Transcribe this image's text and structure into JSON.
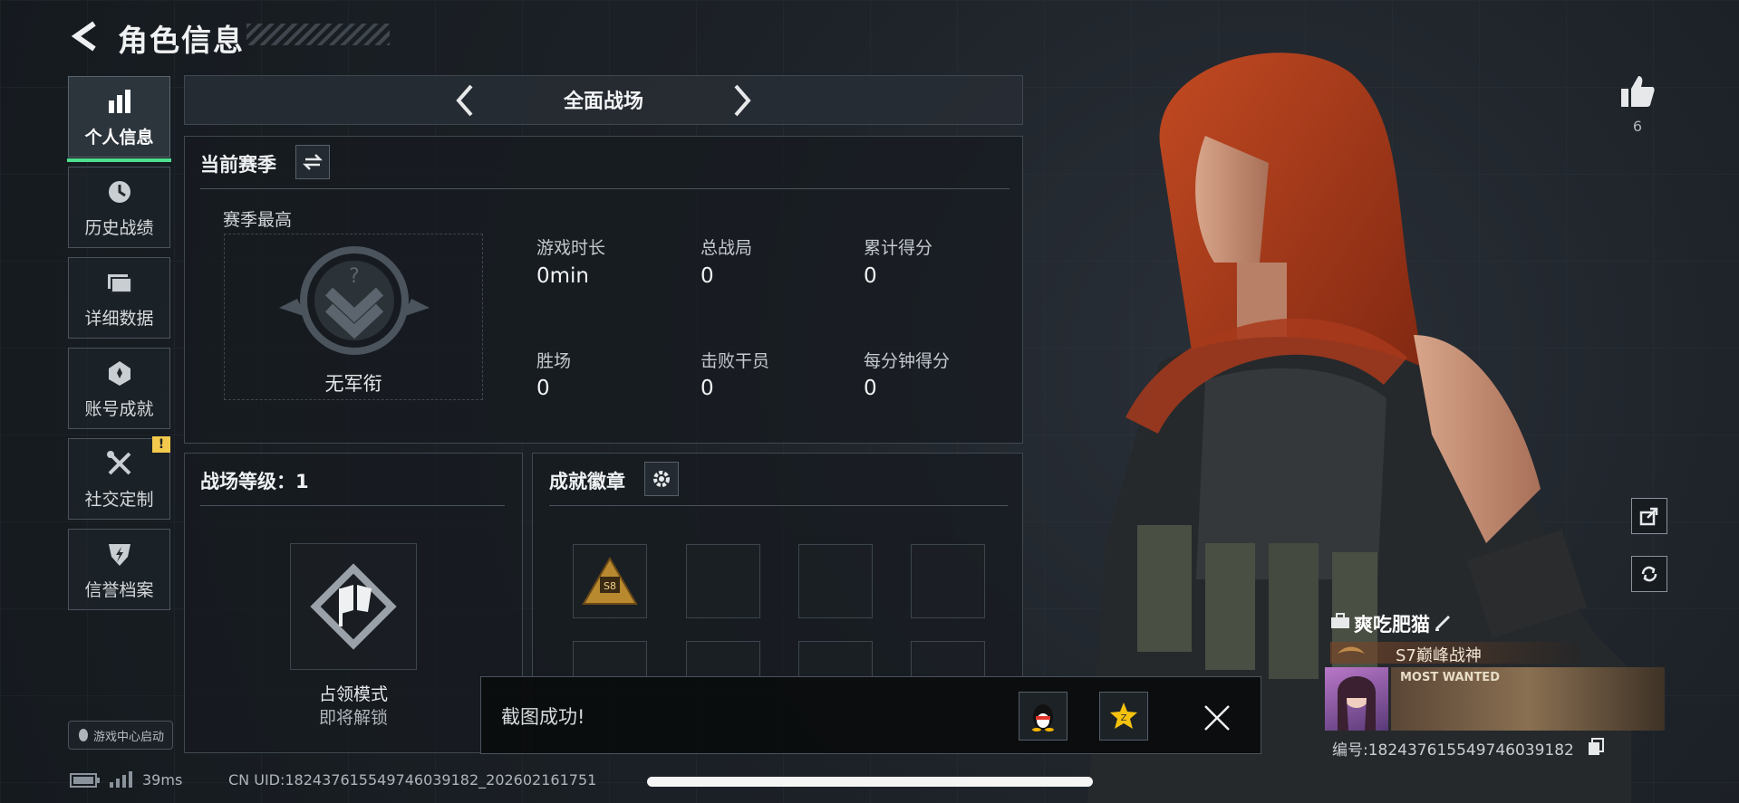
{
  "header": {
    "title": "角色信息"
  },
  "nav": [
    {
      "label": "个人信息",
      "icon": "bar-chart-icon",
      "active": true
    },
    {
      "label": "历史战绩",
      "icon": "clock-icon"
    },
    {
      "label": "详细数据",
      "icon": "folder-icon"
    },
    {
      "label": "账号成就",
      "icon": "medal-icon"
    },
    {
      "label": "社交定制",
      "icon": "tools-icon",
      "badge": "!"
    },
    {
      "label": "信誉档案",
      "icon": "shield-icon"
    }
  ],
  "mode": {
    "label": "全面战场"
  },
  "season": {
    "title": "当前赛季",
    "best_label": "赛季最高",
    "rank_name": "无军衔",
    "stats": [
      {
        "label": "游戏时长",
        "value": "0min"
      },
      {
        "label": "总战局",
        "value": "0"
      },
      {
        "label": "累计得分",
        "value": "0"
      },
      {
        "label": "胜场",
        "value": "0"
      },
      {
        "label": "击败干员",
        "value": "0"
      },
      {
        "label": "每分钟得分",
        "value": "0"
      }
    ]
  },
  "battlefield": {
    "level_text": "战场等级：1",
    "mode_name": "占领模式",
    "mode_status": "即将解锁"
  },
  "badges": {
    "title": "成就徽章",
    "first_badge_text": "S8"
  },
  "game_center": {
    "label": "游戏中心启动"
  },
  "status": {
    "ping": "39ms",
    "uid": "CN UID:18243761554974603918​2_202602161751"
  },
  "toast": {
    "message": "截图成功!"
  },
  "likes": {
    "count": "6"
  },
  "player": {
    "name": "爽吃肥猫",
    "title": "S7巅峰战神",
    "card_text": "MOST WANTED",
    "id_text": "编号:1824376155497460391​82"
  },
  "colors": {
    "accent": "#4ddf8e",
    "warning": "#f2c94c",
    "hair": "#a8391c"
  }
}
